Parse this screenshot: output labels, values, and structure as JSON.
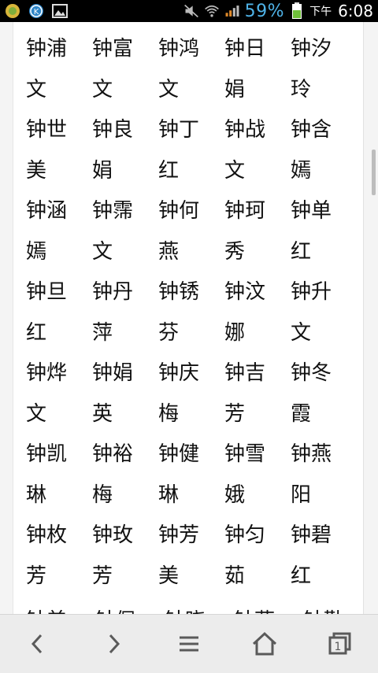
{
  "status_bar": {
    "battery_percent": "59%",
    "time_period": "下午",
    "time": "6:08",
    "icons": [
      "app-icon-green",
      "app-icon-blue-k",
      "image-icon",
      "mute-icon",
      "wifi-icon",
      "signal-icon",
      "battery-icon"
    ]
  },
  "names_rows": [
    [
      "钟浦",
      "钟富",
      "钟鸿",
      "钟日",
      "钟汐"
    ],
    [
      "文",
      "文",
      "文",
      "娟",
      "玲"
    ],
    [
      "钟世",
      "钟良",
      "钟丁",
      "钟战",
      "钟含"
    ],
    [
      "美",
      "娟",
      "红",
      "文",
      "嫣"
    ],
    [
      "钟涵",
      "钟霈",
      "钟何",
      "钟珂",
      "钟单"
    ],
    [
      "嫣",
      "文",
      "燕",
      "秀",
      "红"
    ],
    [
      "钟旦",
      "钟丹",
      "钟锈",
      "钟汶",
      "钟升"
    ],
    [
      "红",
      "萍",
      "芬",
      "娜",
      "文"
    ],
    [
      "钟烨",
      "钟娟",
      "钟庆",
      "钟吉",
      "钟冬"
    ],
    [
      "文",
      "英",
      "梅",
      "芳",
      "霞"
    ],
    [
      "钟凯",
      "钟裕",
      "钟健",
      "钟雪",
      "钟燕"
    ],
    [
      "琳",
      "梅",
      "琳",
      "娥",
      "阳"
    ],
    [
      "钟枚",
      "钟玫",
      "钟芳",
      "钟匀",
      "钟碧"
    ],
    [
      "芳",
      "芳",
      "美",
      "茹",
      "红"
    ]
  ],
  "partial_row": [
    "钟美",
    "钟佩",
    "钟晓",
    "钟燕",
    "钟勤"
  ],
  "bottom_nav": {
    "icons": [
      "back-icon",
      "forward-icon",
      "menu-icon",
      "home-icon",
      "tabs-icon"
    ],
    "tab_count": "1"
  }
}
